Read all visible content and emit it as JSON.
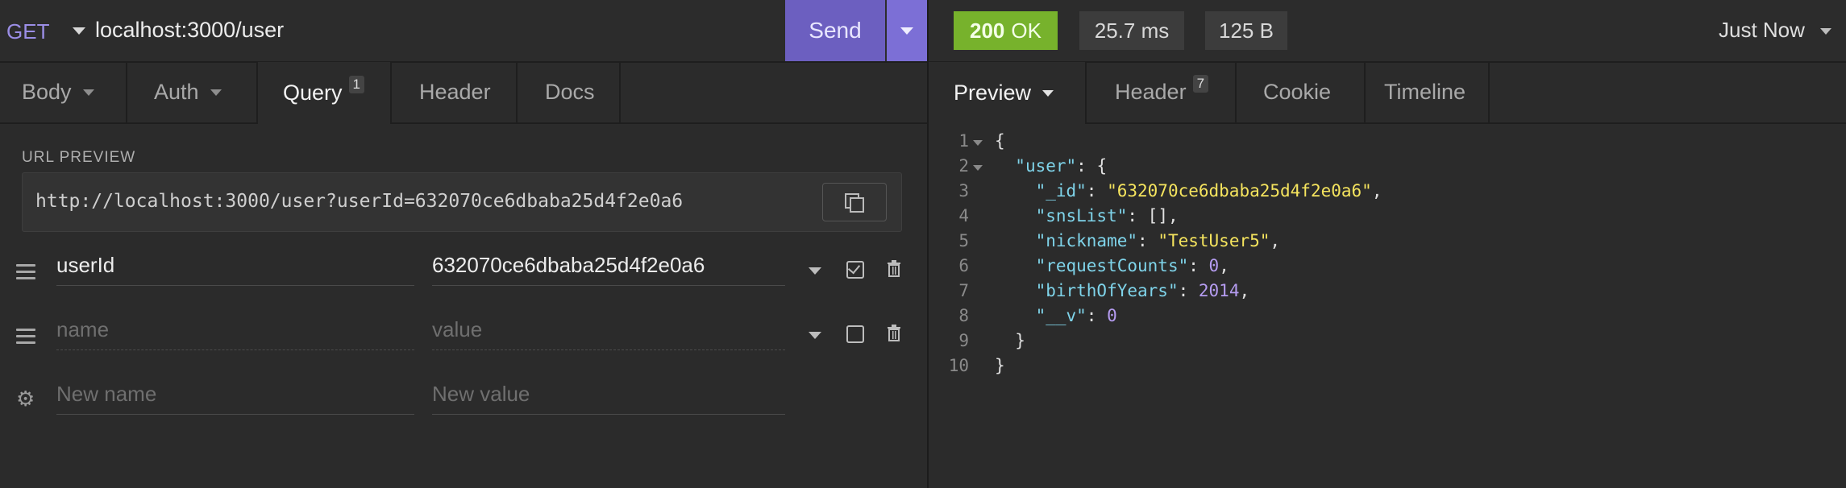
{
  "request": {
    "method": "GET",
    "url": "localhost:3000/user",
    "send_label": "Send",
    "tabs": [
      {
        "label": "Body"
      },
      {
        "label": "Auth"
      },
      {
        "label": "Query",
        "badge": "1"
      },
      {
        "label": "Header"
      },
      {
        "label": "Docs"
      }
    ],
    "url_preview_label": "URL PREVIEW",
    "url_preview": "http://localhost:3000/user?userId=632070ce6dbaba25d4f2e0a6",
    "params": [
      {
        "name": "userId",
        "value": "632070ce6dbaba25d4f2e0a6",
        "enabled": true
      },
      {
        "name_placeholder": "name",
        "value_placeholder": "value",
        "enabled": false
      }
    ],
    "new_param": {
      "name_placeholder": "New name",
      "value_placeholder": "New value"
    }
  },
  "response": {
    "status_code": "200",
    "status_text": "OK",
    "time": "25.7 ms",
    "size": "125 B",
    "history": "Just Now",
    "tabs": [
      {
        "label": "Preview"
      },
      {
        "label": "Header",
        "badge": "7"
      },
      {
        "label": "Cookie"
      },
      {
        "label": "Timeline"
      }
    ],
    "line_numbers": [
      "1",
      "2",
      "3",
      "4",
      "5",
      "6",
      "7",
      "8",
      "9",
      "10"
    ],
    "body": {
      "l1": "{",
      "user_key": "\"user\"",
      "id_key": "\"_id\"",
      "id_val": "\"632070ce6dbaba25d4f2e0a6\"",
      "sns_key": "\"snsList\"",
      "sns_val": "[]",
      "nick_key": "\"nickname\"",
      "nick_val": "\"TestUser5\"",
      "req_key": "\"requestCounts\"",
      "req_val": "0",
      "birth_key": "\"birthOfYears\"",
      "birth_val": "2014",
      "v_key": "\"__v\"",
      "v_val": "0",
      "l9": "}",
      "l10": "}"
    }
  },
  "colors": {
    "accent": "#6c5fc0",
    "ok_badge": "#77b22c",
    "json_key": "#7fd4ea",
    "json_string": "#f5e45e",
    "json_number": "#b59cf0"
  }
}
